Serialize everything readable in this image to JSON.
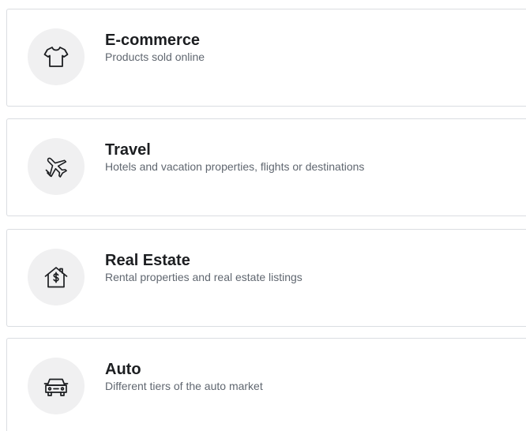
{
  "categories": [
    {
      "title": "E-commerce",
      "subtitle": "Products sold online",
      "icon": "tshirt-icon"
    },
    {
      "title": "Travel",
      "subtitle": "Hotels and vacation properties, flights or destinations",
      "icon": "airplane-icon"
    },
    {
      "title": "Real Estate",
      "subtitle": "Rental properties and real estate listings",
      "icon": "house-dollar-icon"
    },
    {
      "title": "Auto",
      "subtitle": "Different tiers of the auto market",
      "icon": "car-icon"
    }
  ],
  "colors": {
    "border": "#dadde1",
    "icon_background": "#f0f0f1",
    "title": "#1c1e21",
    "subtitle": "#606770"
  }
}
